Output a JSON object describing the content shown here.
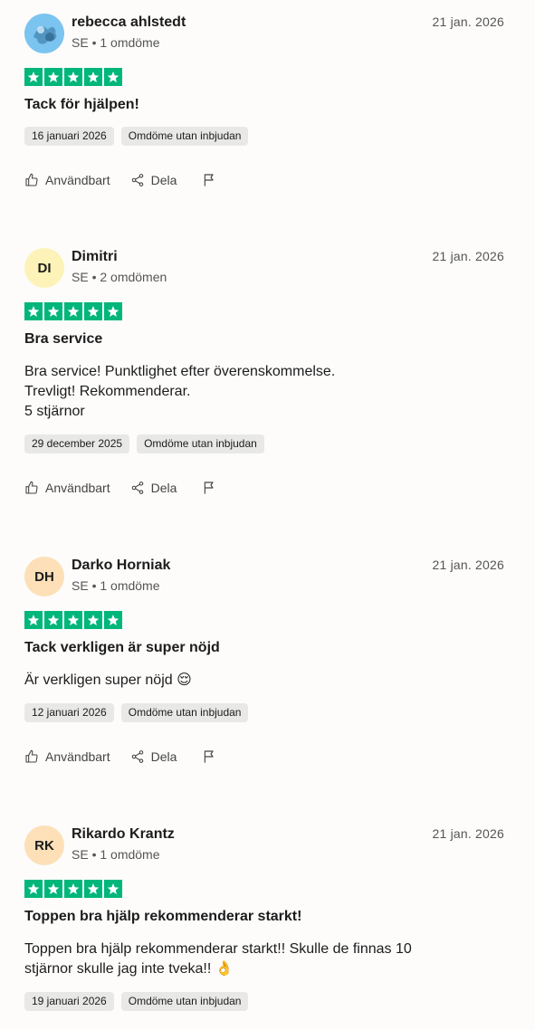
{
  "actions": {
    "useful_label": "Användbart",
    "share_label": "Dela"
  },
  "colors": {
    "star_green": "#00b67a",
    "tag_bg": "#e8e8e6"
  },
  "reviews": [
    {
      "name": "rebecca ahlstedt",
      "meta": "SE • 1 omdöme",
      "date": "21 jan. 2026",
      "avatar": {
        "type": "image",
        "initials": "",
        "color": "#7cc4f0"
      },
      "rating": 5,
      "title": "Tack för hjälpen!",
      "body": "",
      "experience_date": "16 januari 2026",
      "tag": "Omdöme utan inbjudan"
    },
    {
      "name": "Dimitri",
      "meta": "SE • 2 omdömen",
      "date": "21 jan. 2026",
      "avatar": {
        "type": "initials",
        "initials": "DI",
        "color": "#fdf3b8"
      },
      "rating": 5,
      "title": "Bra service",
      "body": "Bra service! Punktlighet efter överenskommelse.\nTrevligt! Rekommenderar.\n5 stjärnor",
      "experience_date": "29 december 2025",
      "tag": "Omdöme utan inbjudan"
    },
    {
      "name": "Darko Horniak",
      "meta": "SE • 1 omdöme",
      "date": "21 jan. 2026",
      "avatar": {
        "type": "initials",
        "initials": "DH",
        "color": "#fde0b8"
      },
      "rating": 5,
      "title": "Tack verkligen är super nöjd",
      "body": "Är verkligen super nöjd 😌",
      "experience_date": "12 januari 2026",
      "tag": "Omdöme utan inbjudan"
    },
    {
      "name": "Rikardo Krantz",
      "meta": "SE • 1 omdöme",
      "date": "21 jan. 2026",
      "avatar": {
        "type": "initials",
        "initials": "RK",
        "color": "#fde0b8"
      },
      "rating": 5,
      "title": "Toppen bra hjälp rekommenderar starkt!",
      "body": "Toppen bra hjälp rekommenderar starkt!! Skulle de finnas 10\nstjärnor skulle jag inte tveka!! 👌",
      "experience_date": "19 januari 2026",
      "tag": "Omdöme utan inbjudan"
    }
  ]
}
